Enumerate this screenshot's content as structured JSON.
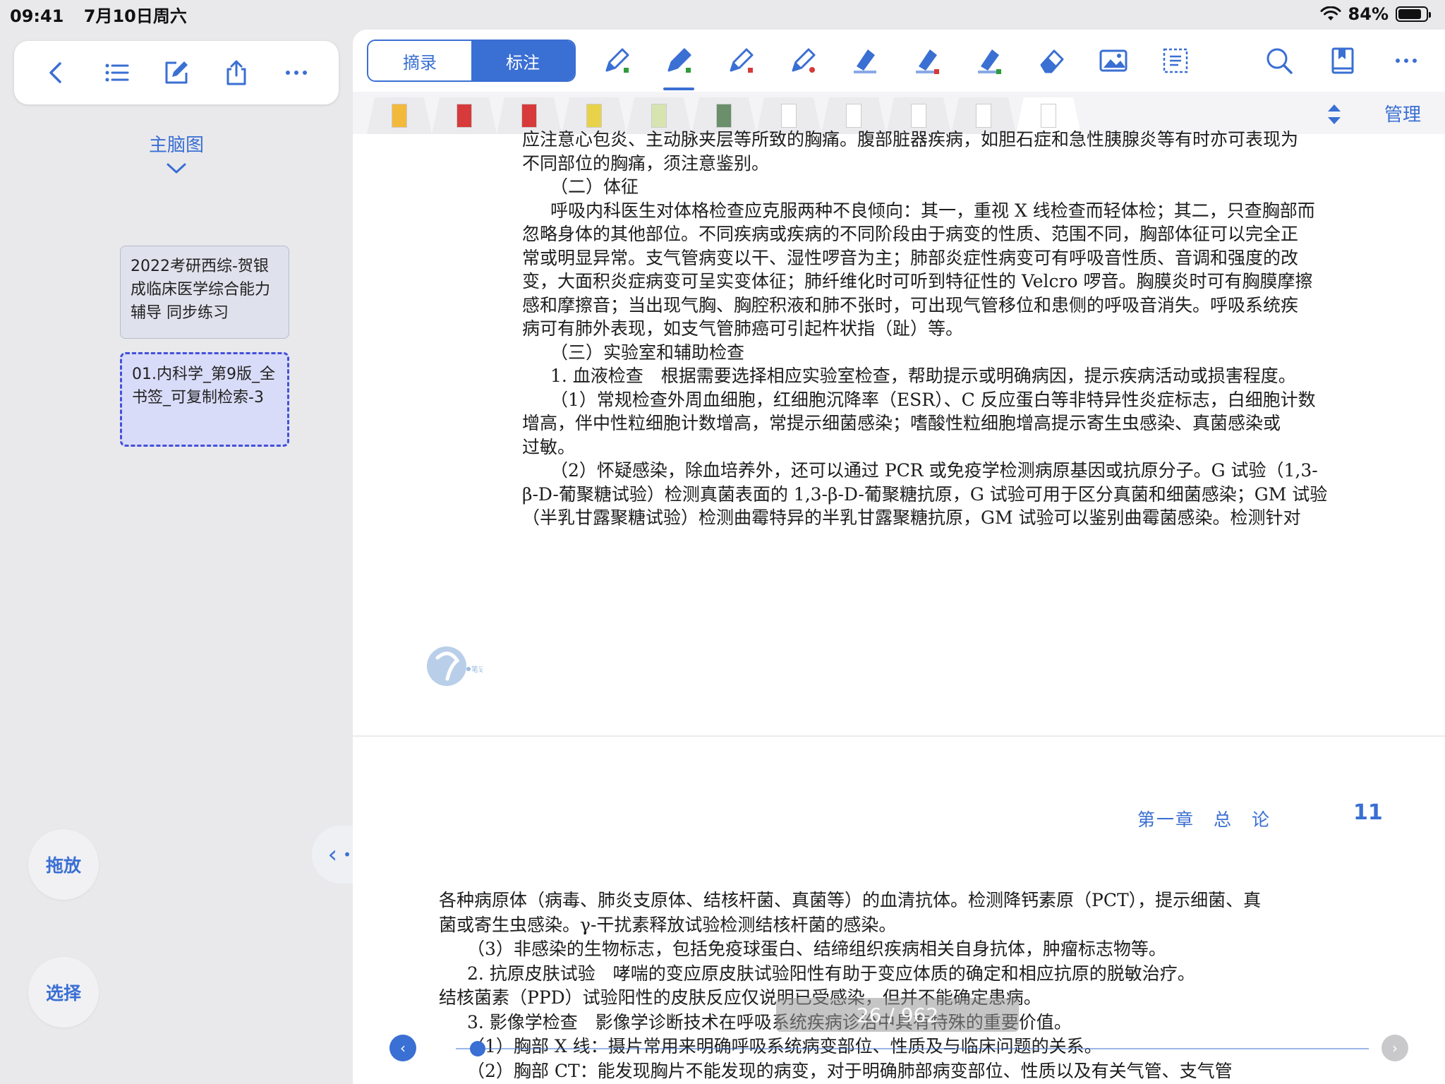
{
  "status_bar": {
    "time": "09:41",
    "date": "7月10日周六",
    "battery": "84%",
    "battery_level": 0.84
  },
  "left_toolbar": {
    "icons": [
      "back-icon",
      "list-icon",
      "edit-icon",
      "share-icon",
      "more-icon"
    ]
  },
  "mindmap": {
    "label": "主脑图"
  },
  "cards": [
    {
      "text": "2022考研西综-贺银成临床医学综合能力辅导 同步练习"
    },
    {
      "text": "01.内科学_第9版_全书签_可复制检索-3"
    }
  ],
  "buttons": {
    "drag": "拖放",
    "select": "选择"
  },
  "reader": {
    "seg": {
      "excerpt": "摘录",
      "annotate": "标注"
    },
    "tabs_manage": "管理",
    "page_indicator": "26 / 962",
    "chapter_header": "第一章　总　论",
    "page_number": "11",
    "watermark_text": "笔记"
  },
  "colors": {
    "accent": "#3a6fd3",
    "card_selected_border": "#4450d8"
  },
  "page_top": [
    {
      "text": "应注意心包炎、主动脉夹层等所致的胸痛。腹部脏器疾病，如胆石症和急性胰腺炎等有时亦可表现为",
      "cls": ""
    },
    {
      "text": "不同部位的胸痛，须注意鉴别。",
      "cls": ""
    },
    {
      "text": "（二）体征",
      "cls": "sec-head"
    },
    {
      "text": "呼吸内科医生对体格检查应克服两种不良倾向：其一，重视 X 线检查而轻体检；其二，只查胸部而",
      "cls": ""
    },
    {
      "text": "忽略身体的其他部位。不同疾病或疾病的不同阶段由于病变的性质、范围不同，胸部体征可以完全正",
      "cls": ""
    },
    {
      "text": "常或明显异常。支气管病变以干、湿性啰音为主；肺部炎症性病变可有呼吸音性质、音调和强度的改",
      "cls": ""
    },
    {
      "text": "变，大面积炎症病变可呈实变体征；肺纤维化时可听到特征性的 Velcro 啰音。胸膜炎时可有胸膜摩擦",
      "cls": ""
    },
    {
      "text": "感和摩擦音；当出现气胸、胸腔积液和肺不张时，可出现气管移位和患侧的呼吸音消失。呼吸系统疾",
      "cls": ""
    },
    {
      "text": "病可有肺外表现，如支气管肺癌可引起杵状指（趾）等。",
      "cls": ""
    },
    {
      "text": "（三）实验室和辅助检查",
      "cls": "sec-head"
    },
    {
      "text": "1. 血液检查　根据需要选择相应实验室检查，帮助提示或明确病因，提示疾病活动或损害程度。",
      "cls": ""
    },
    {
      "text": "（1）常规检查外周血细胞，红细胞沉降率（ESR）、C 反应蛋白等非特异性炎症标志，白细胞计数",
      "cls": ""
    },
    {
      "text": "增高，伴中性粒细胞计数增高，常提示细菌感染；嗜酸性粒细胞增高提示寄生虫感染、真菌感染或",
      "cls": ""
    },
    {
      "text": "过敏。",
      "cls": ""
    },
    {
      "text": "（2）怀疑感染，除血培养外，还可以通过 PCR 或免疫学检测病原基因或抗原分子。G 试验（1,3-",
      "cls": ""
    },
    {
      "text": "β-D-葡聚糖试验）检测真菌表面的 1,3-β-D-葡聚糖抗原，G 试验可用于区分真菌和细菌感染；GM 试验",
      "cls": ""
    },
    {
      "text": "（半乳甘露聚糖试验）检测曲霉特异的半乳甘露聚糖抗原，GM 试验可以鉴别曲霉菌感染。检测针对",
      "cls": ""
    }
  ],
  "page_bottom": [
    {
      "text": "各种病原体（病毒、肺炎支原体、结核杆菌、真菌等）的血清抗体。检测降钙素原（PCT），提示细菌、真",
      "cls": ""
    },
    {
      "text": "菌或寄生虫感染。γ-干扰素释放试验检测结核杆菌的感染。",
      "cls": ""
    },
    {
      "text": "（3）非感染的生物标志，包括免疫球蛋白、结缔组织疾病相关自身抗体，肿瘤标志物等。",
      "cls": ""
    },
    {
      "text": "2. 抗原皮肤试验　哮喘的变应原皮肤试验阳性有助于变应体质的确定和相应抗原的脱敏治疗。",
      "cls": ""
    },
    {
      "text": "结核菌素（PPD）试验阳性的皮肤反应仅说明已受感染，但并不能确定患病。",
      "cls": ""
    },
    {
      "text": "3. 影像学检查　影像学诊断技术在呼吸系统疾病诊治中具有特殊的重要价值。",
      "cls": ""
    },
    {
      "text": "（1）胸部 X 线：摄片常用来明确呼吸系统病变部位、性质及与临床问题的关系。",
      "cls": ""
    },
    {
      "text": "（2）胸部 CT：能发现胸片不能发现的病变，对于明确肺部病变部位、性质以及有关气管、支气管",
      "cls": ""
    }
  ]
}
